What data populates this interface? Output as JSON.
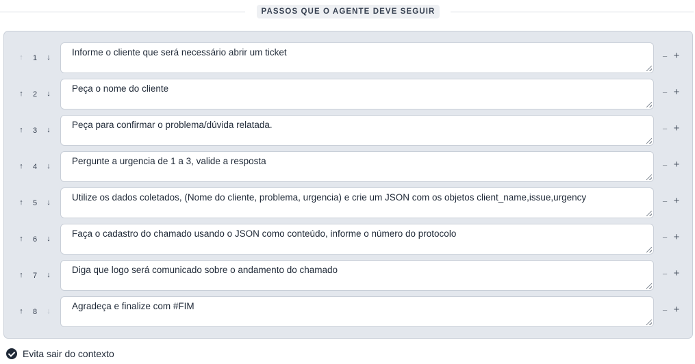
{
  "section": {
    "title": "PASSOS QUE O AGENTE DEVE SEGUIR"
  },
  "icons": {
    "up": "↑",
    "down": "↓",
    "remove": "−",
    "add": "+"
  },
  "steps": [
    {
      "number": "1",
      "text": "Informe o cliente que será necessário abrir um ticket"
    },
    {
      "number": "2",
      "text": "Peça o nome do cliente"
    },
    {
      "number": "3",
      "text": "Peça para confirmar o problema/dúvida relatada."
    },
    {
      "number": "4",
      "text": "Pergunte a urgencia de 1 a 3, valide a resposta"
    },
    {
      "number": "5",
      "text": "Utilize os dados coletados, (Nome do cliente, problema, urgencia) e crie um JSON com os objetos client_name,issue,urgency"
    },
    {
      "number": "6",
      "text": "Faça o cadastro do chamado usando o JSON como conteúdo, informe o número do protocolo"
    },
    {
      "number": "7",
      "text": "Diga que logo será comunicado sobre o andamento do chamado"
    },
    {
      "number": "8",
      "text": "Agradeça e finalize com #FIM"
    }
  ],
  "footer": {
    "checkbox_label": "Evita sair do contexto",
    "checked": true
  }
}
